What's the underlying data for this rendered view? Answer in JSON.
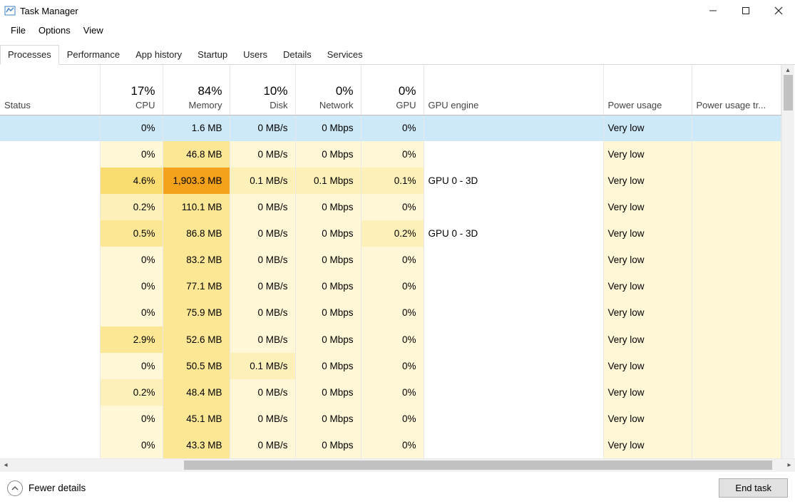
{
  "window": {
    "title": "Task Manager"
  },
  "menu": {
    "items": [
      "File",
      "Options",
      "View"
    ]
  },
  "tabs": {
    "items": [
      "Processes",
      "Performance",
      "App history",
      "Startup",
      "Users",
      "Details",
      "Services"
    ],
    "active_index": 0
  },
  "columns": {
    "status": {
      "label": "Status"
    },
    "cpu": {
      "top": "17%",
      "label": "CPU"
    },
    "mem": {
      "top": "84%",
      "label": "Memory"
    },
    "disk": {
      "top": "10%",
      "label": "Disk"
    },
    "net": {
      "top": "0%",
      "label": "Network"
    },
    "gpu": {
      "top": "0%",
      "label": "GPU"
    },
    "gpueng": {
      "label": "GPU engine"
    },
    "power": {
      "label": "Power usage"
    },
    "powertr": {
      "label": "Power usage tr..."
    }
  },
  "heat_colors": {
    "c0": "#fff7d6",
    "c1": "#fdf0b8",
    "c2": "#fce795",
    "c3": "#fbdc70",
    "c4": "#f9c23c",
    "c5": "#f4a11b"
  },
  "rows": [
    {
      "selected": true,
      "cpu": {
        "v": "0%",
        "h": 0
      },
      "mem": {
        "v": "1.6 MB",
        "h": 0
      },
      "disk": {
        "v": "0 MB/s",
        "h": 0
      },
      "net": {
        "v": "0 Mbps",
        "h": 0
      },
      "gpu": {
        "v": "0%",
        "h": 0
      },
      "gpueng": "",
      "power": "Very low",
      "powertr": ""
    },
    {
      "cpu": {
        "v": "0%",
        "h": 0
      },
      "mem": {
        "v": "46.8 MB",
        "h": 2
      },
      "disk": {
        "v": "0 MB/s",
        "h": 0
      },
      "net": {
        "v": "0 Mbps",
        "h": 0
      },
      "gpu": {
        "v": "0%",
        "h": 0
      },
      "gpueng": "",
      "power": "Very low",
      "powertr": ""
    },
    {
      "cpu": {
        "v": "4.6%",
        "h": 3
      },
      "mem": {
        "v": "1,903.3 MB",
        "h": 5
      },
      "disk": {
        "v": "0.1 MB/s",
        "h": 1
      },
      "net": {
        "v": "0.1 Mbps",
        "h": 1
      },
      "gpu": {
        "v": "0.1%",
        "h": 1
      },
      "gpueng": "GPU 0 - 3D",
      "power": "Very low",
      "powertr": ""
    },
    {
      "cpu": {
        "v": "0.2%",
        "h": 1
      },
      "mem": {
        "v": "110.1 MB",
        "h": 2
      },
      "disk": {
        "v": "0 MB/s",
        "h": 0
      },
      "net": {
        "v": "0 Mbps",
        "h": 0
      },
      "gpu": {
        "v": "0%",
        "h": 0
      },
      "gpueng": "",
      "power": "Very low",
      "powertr": ""
    },
    {
      "cpu": {
        "v": "0.5%",
        "h": 2
      },
      "mem": {
        "v": "86.8 MB",
        "h": 2
      },
      "disk": {
        "v": "0 MB/s",
        "h": 0
      },
      "net": {
        "v": "0 Mbps",
        "h": 0
      },
      "gpu": {
        "v": "0.2%",
        "h": 1
      },
      "gpueng": "GPU 0 - 3D",
      "power": "Very low",
      "powertr": ""
    },
    {
      "cpu": {
        "v": "0%",
        "h": 0
      },
      "mem": {
        "v": "83.2 MB",
        "h": 2
      },
      "disk": {
        "v": "0 MB/s",
        "h": 0
      },
      "net": {
        "v": "0 Mbps",
        "h": 0
      },
      "gpu": {
        "v": "0%",
        "h": 0
      },
      "gpueng": "",
      "power": "Very low",
      "powertr": ""
    },
    {
      "cpu": {
        "v": "0%",
        "h": 0
      },
      "mem": {
        "v": "77.1 MB",
        "h": 2
      },
      "disk": {
        "v": "0 MB/s",
        "h": 0
      },
      "net": {
        "v": "0 Mbps",
        "h": 0
      },
      "gpu": {
        "v": "0%",
        "h": 0
      },
      "gpueng": "",
      "power": "Very low",
      "powertr": ""
    },
    {
      "cpu": {
        "v": "0%",
        "h": 0
      },
      "mem": {
        "v": "75.9 MB",
        "h": 2
      },
      "disk": {
        "v": "0 MB/s",
        "h": 0
      },
      "net": {
        "v": "0 Mbps",
        "h": 0
      },
      "gpu": {
        "v": "0%",
        "h": 0
      },
      "gpueng": "",
      "power": "Very low",
      "powertr": ""
    },
    {
      "cpu": {
        "v": "2.9%",
        "h": 2
      },
      "mem": {
        "v": "52.6 MB",
        "h": 2
      },
      "disk": {
        "v": "0 MB/s",
        "h": 0
      },
      "net": {
        "v": "0 Mbps",
        "h": 0
      },
      "gpu": {
        "v": "0%",
        "h": 0
      },
      "gpueng": "",
      "power": "Very low",
      "powertr": ""
    },
    {
      "cpu": {
        "v": "0%",
        "h": 0
      },
      "mem": {
        "v": "50.5 MB",
        "h": 2
      },
      "disk": {
        "v": "0.1 MB/s",
        "h": 1
      },
      "net": {
        "v": "0 Mbps",
        "h": 0
      },
      "gpu": {
        "v": "0%",
        "h": 0
      },
      "gpueng": "",
      "power": "Very low",
      "powertr": ""
    },
    {
      "cpu": {
        "v": "0.2%",
        "h": 1
      },
      "mem": {
        "v": "48.4 MB",
        "h": 2
      },
      "disk": {
        "v": "0 MB/s",
        "h": 0
      },
      "net": {
        "v": "0 Mbps",
        "h": 0
      },
      "gpu": {
        "v": "0%",
        "h": 0
      },
      "gpueng": "",
      "power": "Very low",
      "powertr": ""
    },
    {
      "cpu": {
        "v": "0%",
        "h": 0
      },
      "mem": {
        "v": "45.1 MB",
        "h": 2
      },
      "disk": {
        "v": "0 MB/s",
        "h": 0
      },
      "net": {
        "v": "0 Mbps",
        "h": 0
      },
      "gpu": {
        "v": "0%",
        "h": 0
      },
      "gpueng": "",
      "power": "Very low",
      "powertr": ""
    },
    {
      "cpu": {
        "v": "0%",
        "h": 0
      },
      "mem": {
        "v": "43.3 MB",
        "h": 2
      },
      "disk": {
        "v": "0 MB/s",
        "h": 0
      },
      "net": {
        "v": "0 Mbps",
        "h": 0
      },
      "gpu": {
        "v": "0%",
        "h": 0
      },
      "gpueng": "",
      "power": "Very low",
      "powertr": ""
    }
  ],
  "footer": {
    "fewer_details": "Fewer details",
    "end_task": "End task"
  }
}
